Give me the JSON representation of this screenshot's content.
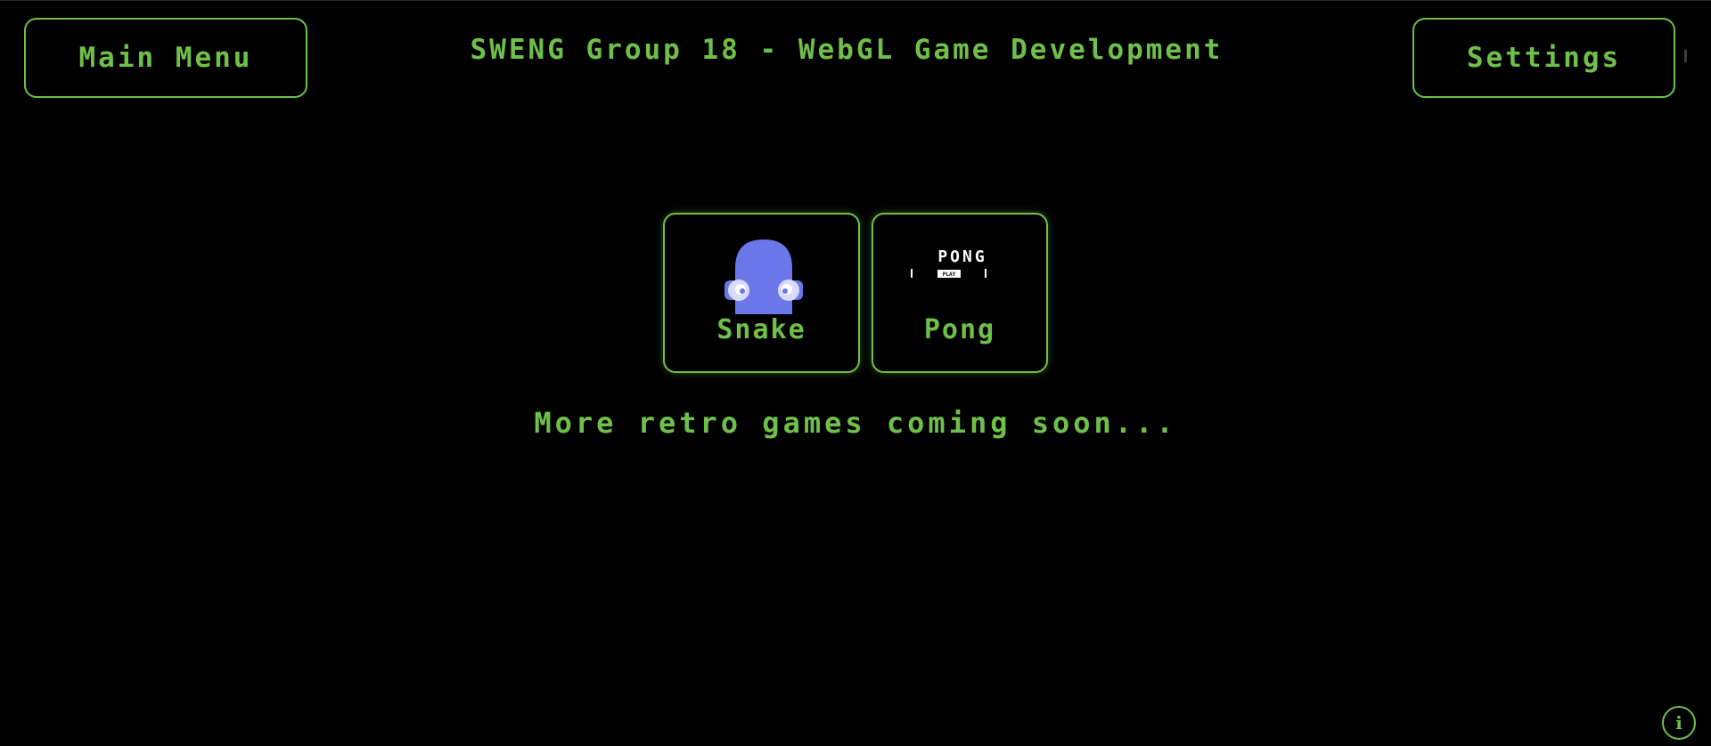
{
  "header": {
    "title": "SWENG Group 18 - WebGL Game Development",
    "main_menu_label": "Main Menu",
    "settings_label": "Settings"
  },
  "games": [
    {
      "label": "Snake",
      "icon": "ghost-icon"
    },
    {
      "label": "Pong",
      "icon": "pong-thumbnail",
      "thumb_title": "PONG",
      "thumb_button": "PLAY"
    }
  ],
  "footer_text": "More retro games coming soon...",
  "info_button": {
    "icon": "info-icon",
    "glyph": "i"
  },
  "colors": {
    "background": "#000000",
    "accent": "#6fc04a",
    "ghost": "#6b76e8",
    "ghost_eye": "#d8dbff"
  }
}
